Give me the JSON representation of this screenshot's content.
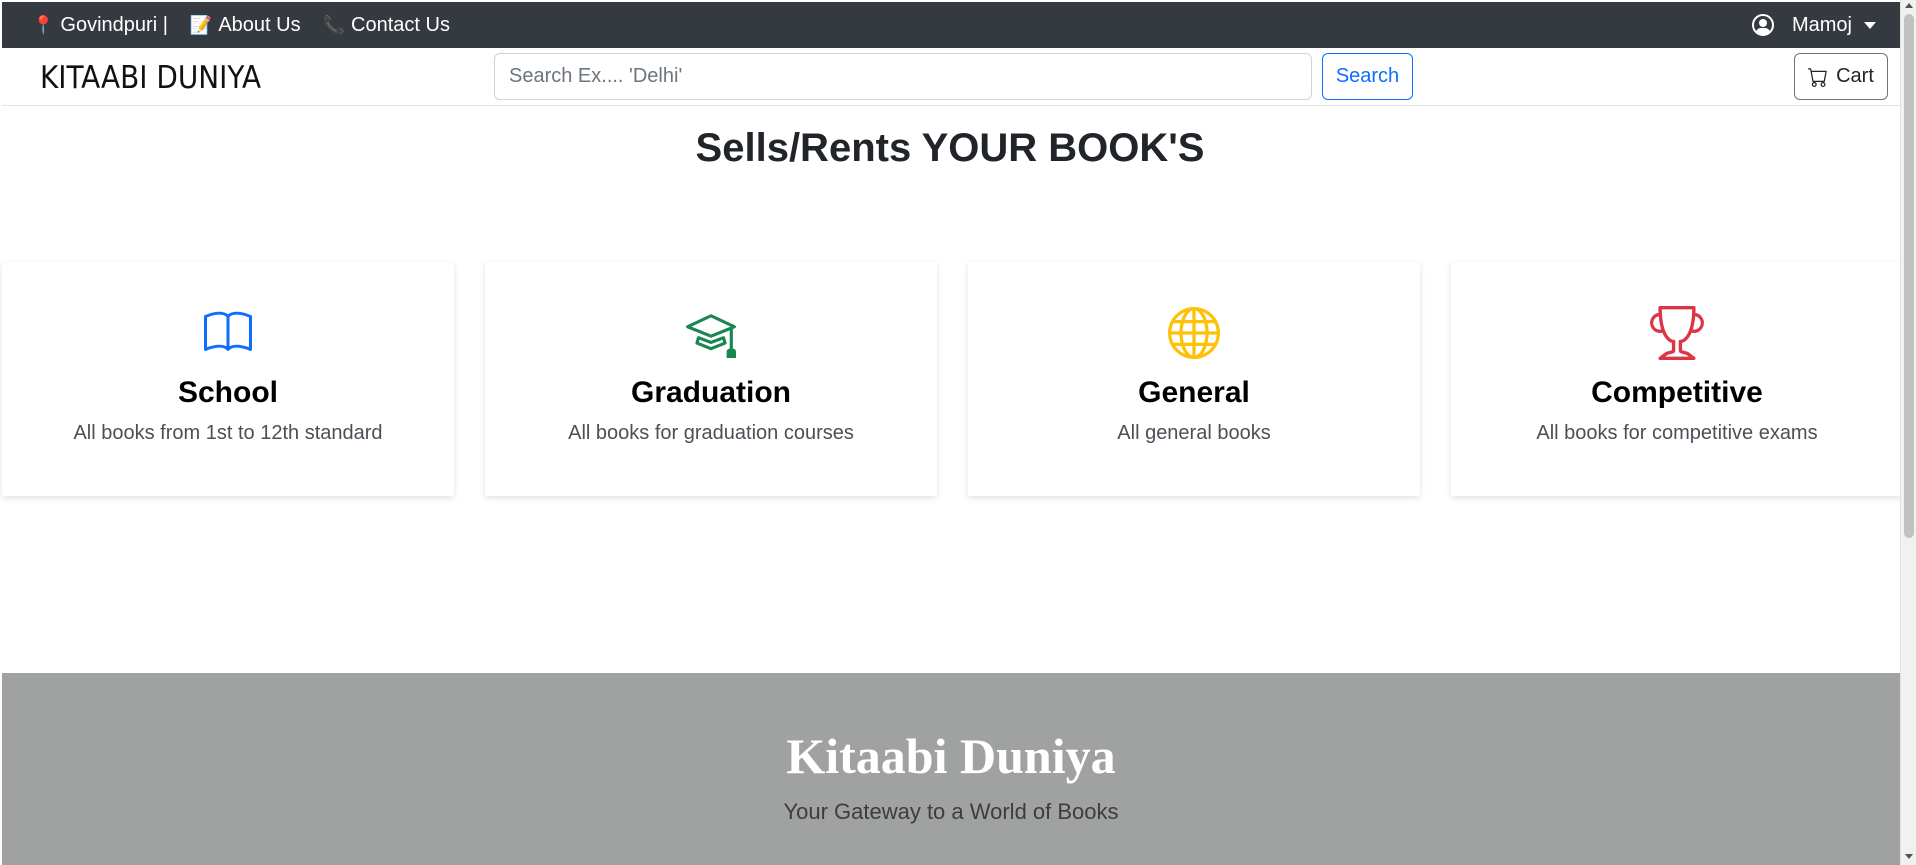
{
  "topbar": {
    "location_label": "Govindpuri |",
    "about_label": "About Us",
    "contact_label": "Contact Us",
    "user_name": "Mamoj",
    "icons": {
      "location": "pushpin-icon",
      "about": "memo-icon",
      "contact": "phone-icon",
      "user": "user-circle-icon"
    }
  },
  "navbar": {
    "brand": "KITAABI DUNIYA",
    "search_placeholder": "Search Ex.... 'Delhi'",
    "search_label": "Search",
    "cart_label": "Cart"
  },
  "main": {
    "heading": "Sells/Rents YOUR BOOK'S",
    "cards": [
      {
        "title": "School",
        "desc": "All books from 1st to 12th standard",
        "icon": "book-icon",
        "color": "#0d6efd"
      },
      {
        "title": "Graduation",
        "desc": "All books for graduation courses",
        "icon": "mortarboard-icon",
        "color": "#198754"
      },
      {
        "title": "General",
        "desc": "All general books",
        "icon": "globe-icon",
        "color": "#ffc107"
      },
      {
        "title": "Competitive",
        "desc": "All books for competitive exams",
        "icon": "trophy-icon",
        "color": "#dc3545"
      }
    ]
  },
  "footer": {
    "title": "Kitaabi Duniya",
    "tagline": "Your Gateway to a World of Books"
  }
}
